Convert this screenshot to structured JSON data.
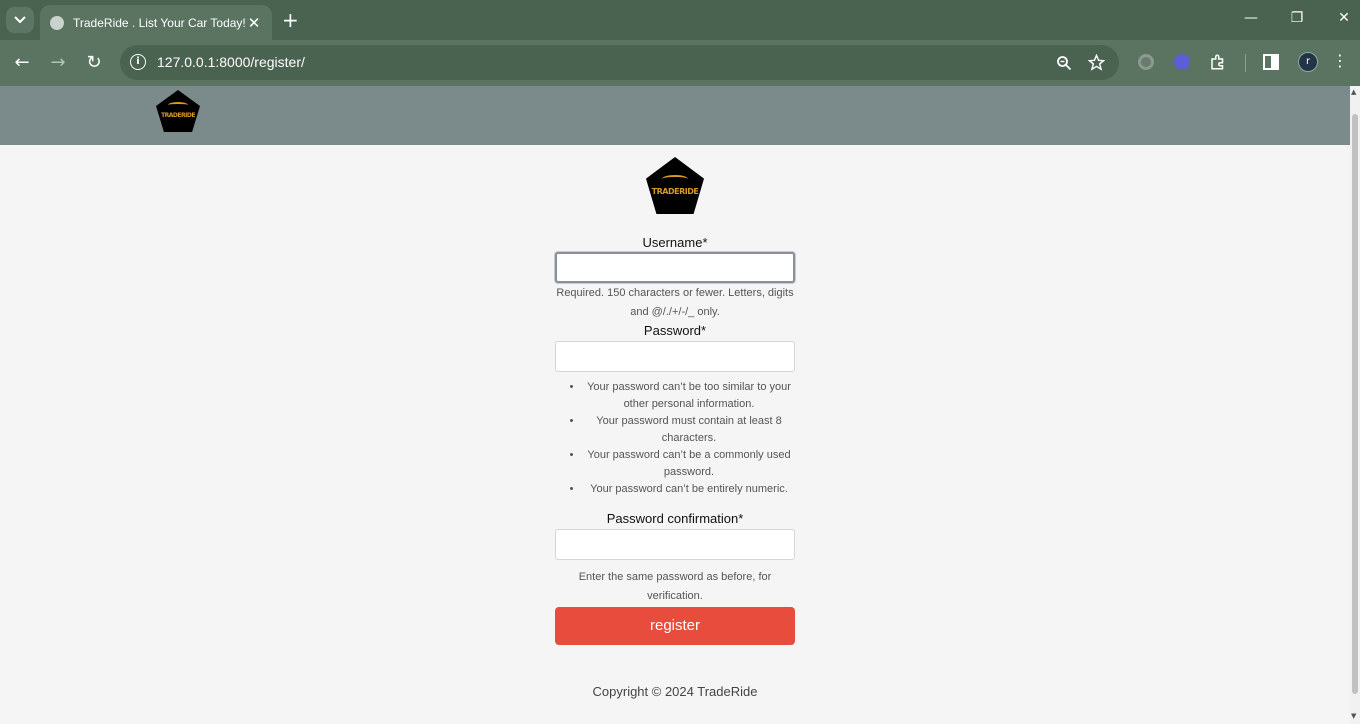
{
  "browser": {
    "tab_title": "TradeRide . List Your Car Today!",
    "tab_close": "✕",
    "new_tab": "+",
    "url": "127.0.0.1:8000/register/",
    "avatar_letter": "r",
    "minimize": "—",
    "restore": "❐",
    "close": "✕"
  },
  "header": {
    "logo_text": "TRADERIDE"
  },
  "form": {
    "logo_text": "TRADERIDE",
    "username_label": "Username*",
    "username_value": "",
    "username_help": "Required. 150 characters or fewer. Letters, digits and @/./+/-/_ only.",
    "password_label": "Password*",
    "password_value": "",
    "password_rules": [
      "Your password can’t be too similar to your other personal information.",
      "Your password must contain at least 8 characters.",
      "Your password can’t be a commonly used password.",
      "Your password can’t be entirely numeric."
    ],
    "confirm_label": "Password confirmation*",
    "confirm_value": "",
    "confirm_help": "Enter the same password as before, for verification.",
    "submit_label": "register"
  },
  "footer": {
    "copyright": "Copyright © 2024 TradeRide"
  },
  "colors": {
    "header_bg": "#7b8a8a",
    "button": "#e74c3c",
    "logo_gold": "#d79a23",
    "chrome": "#4a6250"
  }
}
